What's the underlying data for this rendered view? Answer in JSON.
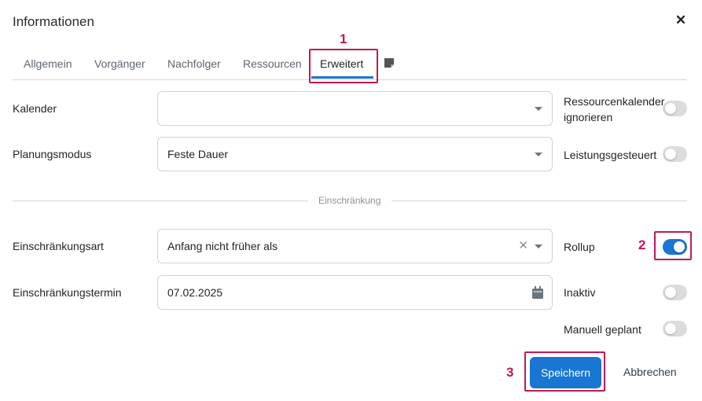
{
  "dialog": {
    "title": "Informationen",
    "close_icon": "close-icon"
  },
  "tabs": [
    {
      "label": "Allgemein",
      "active": false
    },
    {
      "label": "Vorgänger",
      "active": false
    },
    {
      "label": "Nachfolger",
      "active": false
    },
    {
      "label": "Ressourcen",
      "active": false
    },
    {
      "label": "Erweitert",
      "active": true
    }
  ],
  "notes_tab_icon": "sticky-note-icon",
  "callouts": [
    "1",
    "2",
    "3"
  ],
  "form": {
    "calendar": {
      "label": "Kalender",
      "value": ""
    },
    "scheduling_mode": {
      "label": "Planungsmodus",
      "value": "Feste Dauer"
    },
    "ignore_resource_calendar": {
      "label_line1": "Ressourcenkalender",
      "label_line2": "ignorieren",
      "on": false
    },
    "effort_driven": {
      "label": "Leistungsgesteuert",
      "on": false
    },
    "divider": "Einschränkung",
    "constraint_type": {
      "label": "Einschränkungsart",
      "value": "Anfang nicht früher als"
    },
    "rollup": {
      "label": "Rollup",
      "on": true
    },
    "constraint_date": {
      "label": "Einschränkungstermin",
      "value": "07.02.2025"
    },
    "inactive": {
      "label": "Inaktiv",
      "on": false
    },
    "manually_scheduled": {
      "label": "Manuell geplant",
      "on": false
    }
  },
  "buttons": {
    "save": "Speichern",
    "cancel": "Abbrechen"
  },
  "colors": {
    "accent": "#1976d2",
    "callout": "#c2185b",
    "toggle_off": "#dcdcdc"
  }
}
